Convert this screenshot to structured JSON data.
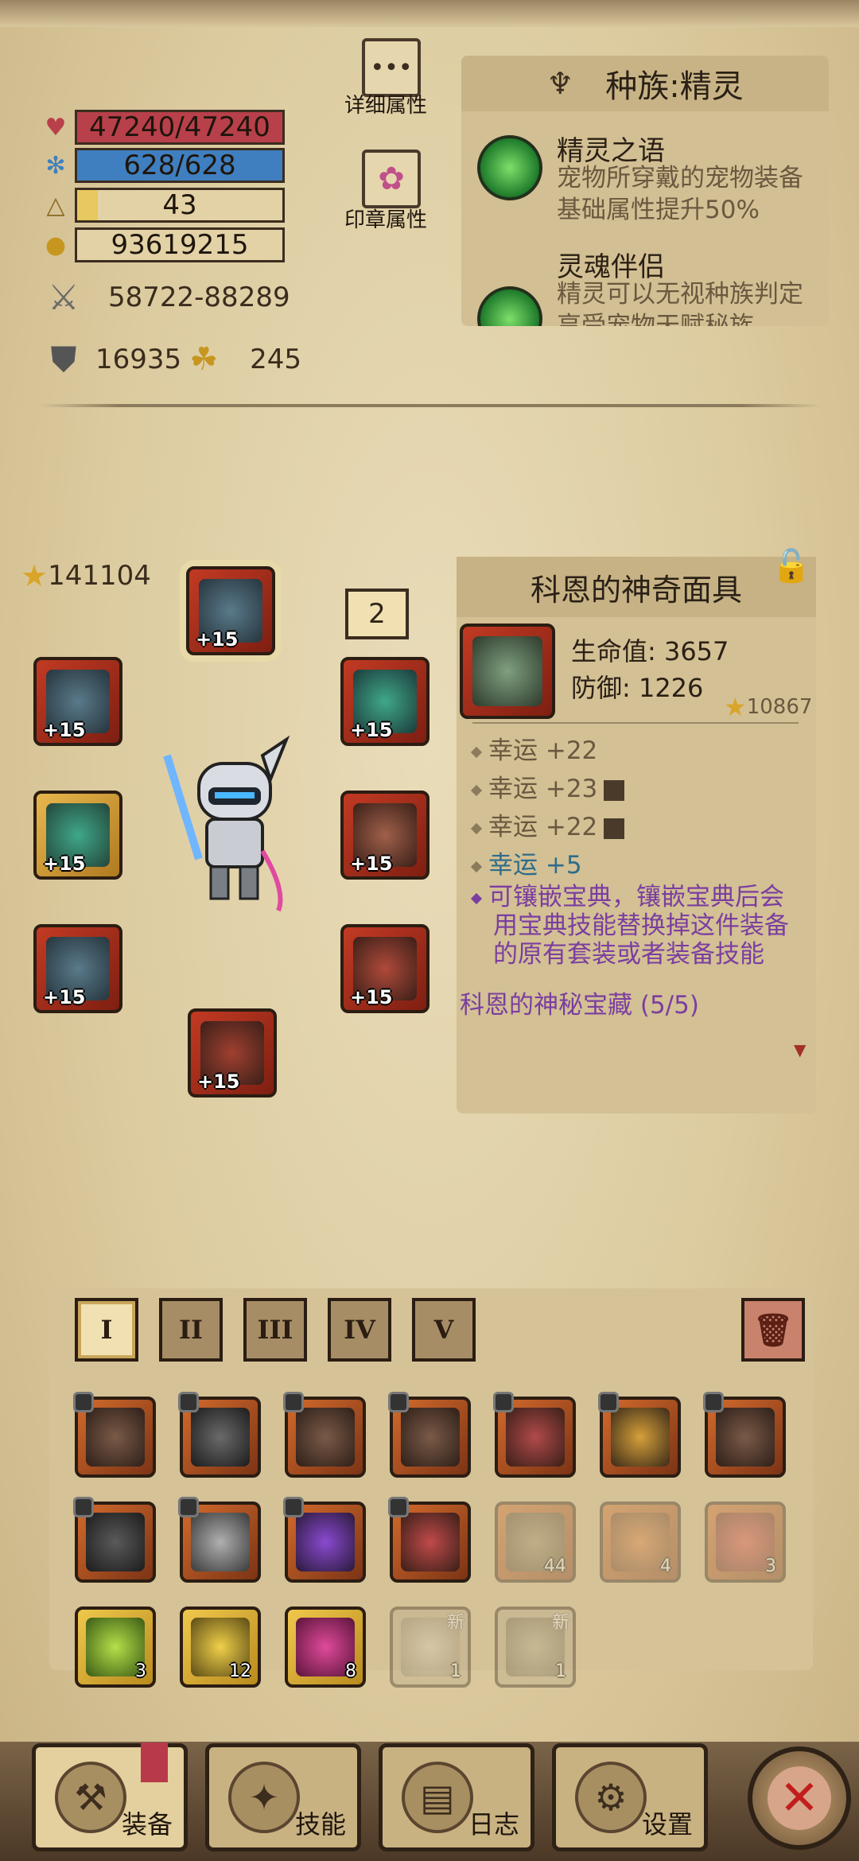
{
  "stats": {
    "hp": "47240/47240",
    "hp_fill": 1.0,
    "mp": "628/628",
    "mp_fill": 1.0,
    "level": "43",
    "level_fill": 0.1,
    "gold": "93619215",
    "attack": "58722-88289",
    "defense": "16935",
    "luck": "245"
  },
  "buttons": {
    "detail_attr": "详细属性",
    "seal_attr": "印章属性"
  },
  "race": {
    "title": "种族:精灵",
    "skills": [
      {
        "name": "精灵之语",
        "desc": "宠物所穿戴的宠物装备基础属性提升50%"
      },
      {
        "name": "灵魂伴侣",
        "desc": "精灵可以无视种族判定享受宠物天赋秘族"
      }
    ]
  },
  "equipment": {
    "power_score": "141104",
    "set_badge": "2",
    "slot_level": "+15"
  },
  "item": {
    "name": "科恩的神奇面具",
    "hp_line": "生命值: 3657",
    "def_line": "防御: 1226",
    "score": "10867",
    "attrs": [
      "幸运 +22",
      "幸运 +23",
      "幸运 +22",
      "幸运 +5"
    ],
    "socket_text": "可镶嵌宝典，镶嵌宝典后会用宝典技能替换掉这件装备的原有套装或者装备技能",
    "set_name": "科恩的神秘宝藏 (5/5)"
  },
  "inventory": {
    "tabs": [
      "I",
      "II",
      "III",
      "IV",
      "V"
    ],
    "counts": {
      "pickaxe": "44",
      "potion_orange": "4",
      "potion_red": "3",
      "green_potion": "3",
      "yellow_potion": "12",
      "pink_potion": "8",
      "feather": "1",
      "pick2": "1"
    },
    "new_label": "新"
  },
  "nav": {
    "equip": "装备",
    "skills": "技能",
    "log": "日志",
    "settings": "设置"
  },
  "colors": {
    "hp_bar": "#b8404a",
    "mp_bar": "#3f7fbf",
    "xp_bar": "#e8c860",
    "gold_bar": "#e3d2a6",
    "socket_text": "#7b3ea0",
    "blue_attr": "#2f6c8a"
  }
}
